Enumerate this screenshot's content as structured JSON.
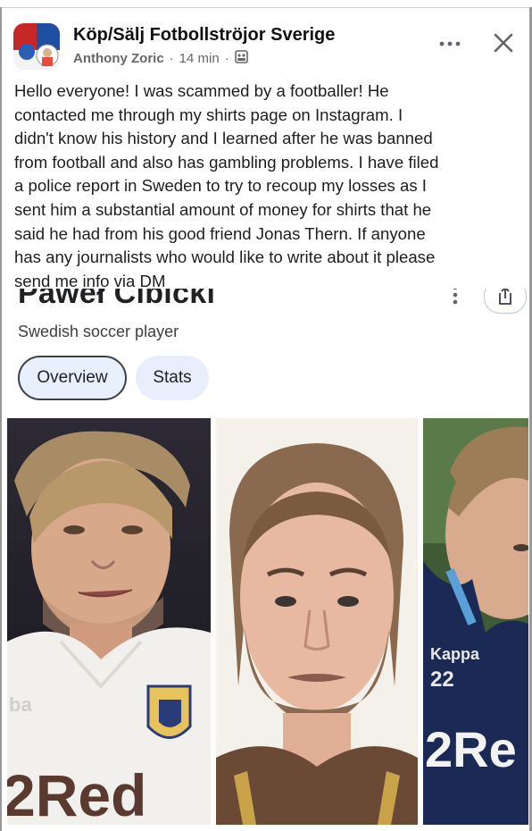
{
  "post": {
    "group_name": "Köp/Sälj Fotbollströjor Sverige",
    "author": "Anthony Zoric",
    "time": "14 min",
    "text": "Hello everyone! I was scammed by a footballer! He\ncontacted me through my shirts page on Instagram. I\ndidn't know his history and I learned after he was banned\nfrom football and also has gambling problems. I have filed\na police report in Sweden to try to recoup my losses as I\nsent him a substantial amount of money for shirts that he\nsaid he had from his good friend Jonas Thern. If anyone\nhas any journalists who would like to write about it please\nsend me info via DM",
    "icons": {
      "more": "more-horizontal-icon",
      "close": "close-icon",
      "audience": "group-audience-icon"
    }
  },
  "knowledge_panel": {
    "title": "Paweł Cibicki",
    "subtitle": "Swedish soccer player",
    "tabs": [
      {
        "label": "Overview",
        "selected": true
      },
      {
        "label": "Stats",
        "selected": false
      }
    ]
  },
  "photos": {
    "shirt_text_1": "2Red",
    "shirt_text_3": "2Re",
    "shirt_number": "22",
    "brand_1": "ba",
    "brand_3": "Kappa"
  },
  "colors": {
    "accent_tab": "#e8f0fe",
    "text_primary": "#1c1e21",
    "text_secondary": "#65676b"
  }
}
